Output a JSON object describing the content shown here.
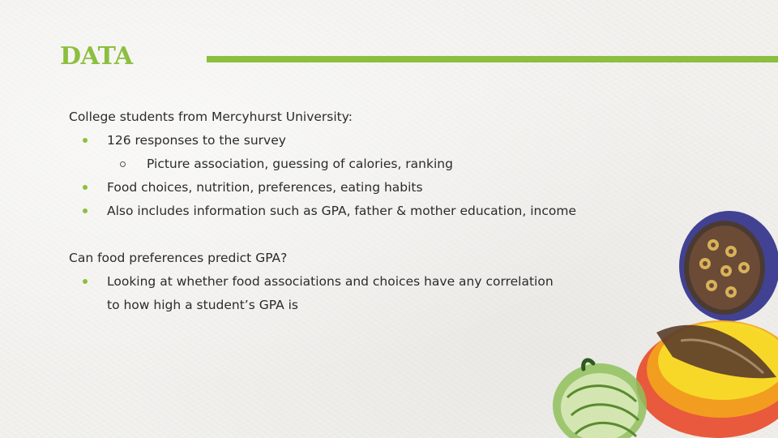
{
  "slide": {
    "title": "DATA"
  },
  "section1": {
    "heading": "College students from Mercyhurst University:",
    "bullets": [
      "126 responses to the survey",
      "Picture association, guessing of calories, ranking",
      "Food choices, nutrition, preferences, eating habits",
      "Also includes information such as GPA, father & mother education, income"
    ]
  },
  "section2": {
    "heading": "Can food preferences predict GPA?",
    "bullets": [
      "Looking at whether food associations and choices have any correlation to how high a student’s GPA is"
    ]
  },
  "colors": {
    "accent": "#8cbf3f",
    "text": "#2b2b2b"
  }
}
